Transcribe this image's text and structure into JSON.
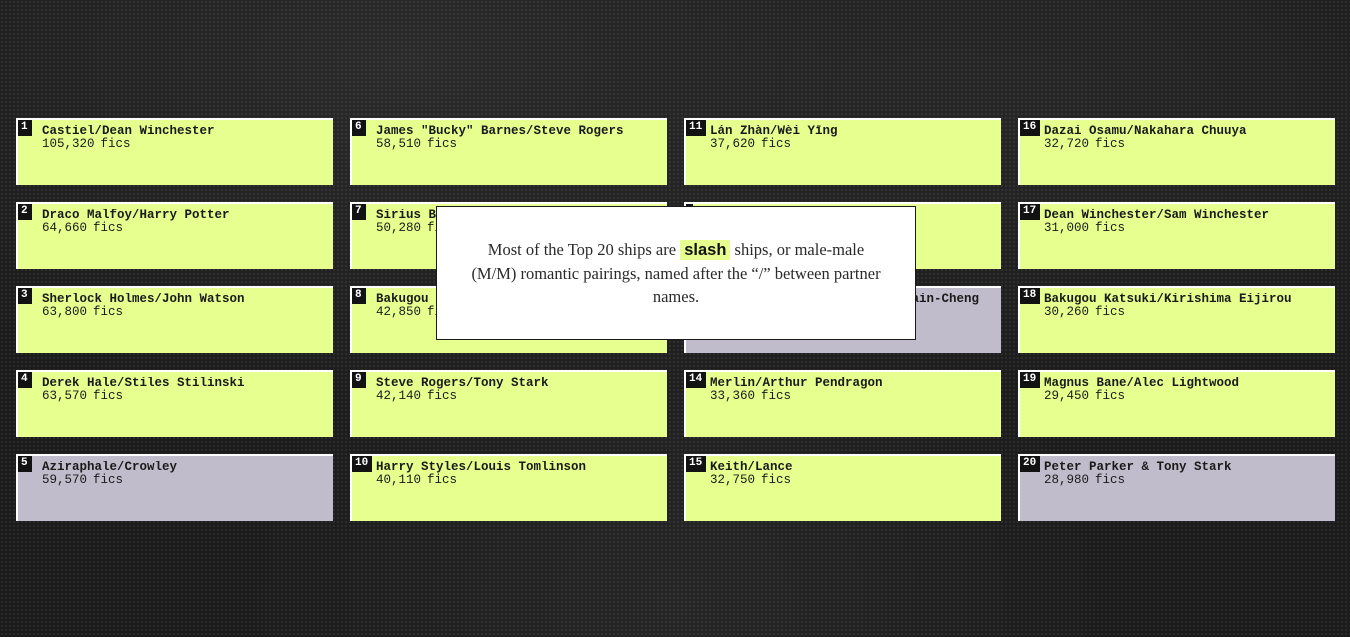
{
  "ships": [
    {
      "rank": "1",
      "name": "Castiel/Dean Winchester",
      "count": "105,320",
      "type": "slash"
    },
    {
      "rank": "2",
      "name": "Draco Malfoy/Harry Potter",
      "count": "64,660",
      "type": "slash"
    },
    {
      "rank": "3",
      "name": "Sherlock Holmes/John Watson",
      "count": "63,800",
      "type": "slash"
    },
    {
      "rank": "4",
      "name": "Derek Hale/Stiles Stilinski",
      "count": "63,570",
      "type": "slash"
    },
    {
      "rank": "5",
      "name": "Aziraphale/Crowley",
      "count": "59,570",
      "type": "other"
    },
    {
      "rank": "6",
      "name": "James \"Bucky\" Barnes/Steve Rogers",
      "count": "58,510",
      "type": "slash"
    },
    {
      "rank": "7",
      "name": "Sirius Bl",
      "count": "50,280",
      "type": "slash"
    },
    {
      "rank": "8",
      "name": "Bakugou K",
      "count": "42,850",
      "type": "slash"
    },
    {
      "rank": "9",
      "name": "Steve Rogers/Tony Stark",
      "count": "42,140",
      "type": "slash"
    },
    {
      "rank": "10",
      "name": "Harry Styles/Louis Tomlinson",
      "count": "40,110",
      "type": "slash"
    },
    {
      "rank": "11",
      "name": "Lán Zhàn/Wèi Yīng",
      "count": "37,620",
      "type": "slash"
    },
    {
      "rank": "",
      "name": "",
      "count": "",
      "type": "slash"
    },
    {
      "rank": "",
      "name": "ain-Cheng",
      "count": "",
      "type": "other"
    },
    {
      "rank": "14",
      "name": "Merlin/Arthur Pendragon",
      "count": "33,360",
      "type": "slash"
    },
    {
      "rank": "15",
      "name": "Keith/Lance",
      "count": "32,750",
      "type": "slash"
    },
    {
      "rank": "16",
      "name": "Dazai Osamu/Nakahara Chuuya",
      "count": "32,720",
      "type": "slash"
    },
    {
      "rank": "17",
      "name": "Dean Winchester/Sam Winchester",
      "count": "31,000",
      "type": "slash"
    },
    {
      "rank": "18",
      "name": "Bakugou Katsuki/Kirishima Eijirou",
      "count": "30,260",
      "type": "slash"
    },
    {
      "rank": "19",
      "name": "Magnus Bane/Alec Lightwood",
      "count": "29,450",
      "type": "slash"
    },
    {
      "rank": "20",
      "name": "Peter Parker & Tony Stark",
      "count": "28,980",
      "type": "other"
    }
  ],
  "unit_label": "fics",
  "tooltip": {
    "before": "Most of the Top 20 ships are",
    "highlight": "slash",
    "after": "ships, or male-male (M/M) romantic pairings, named after the “/” between partner names."
  },
  "colors": {
    "slash": "#e6ff8f",
    "other": "#c1bccb",
    "background": "#1b1b1b"
  }
}
